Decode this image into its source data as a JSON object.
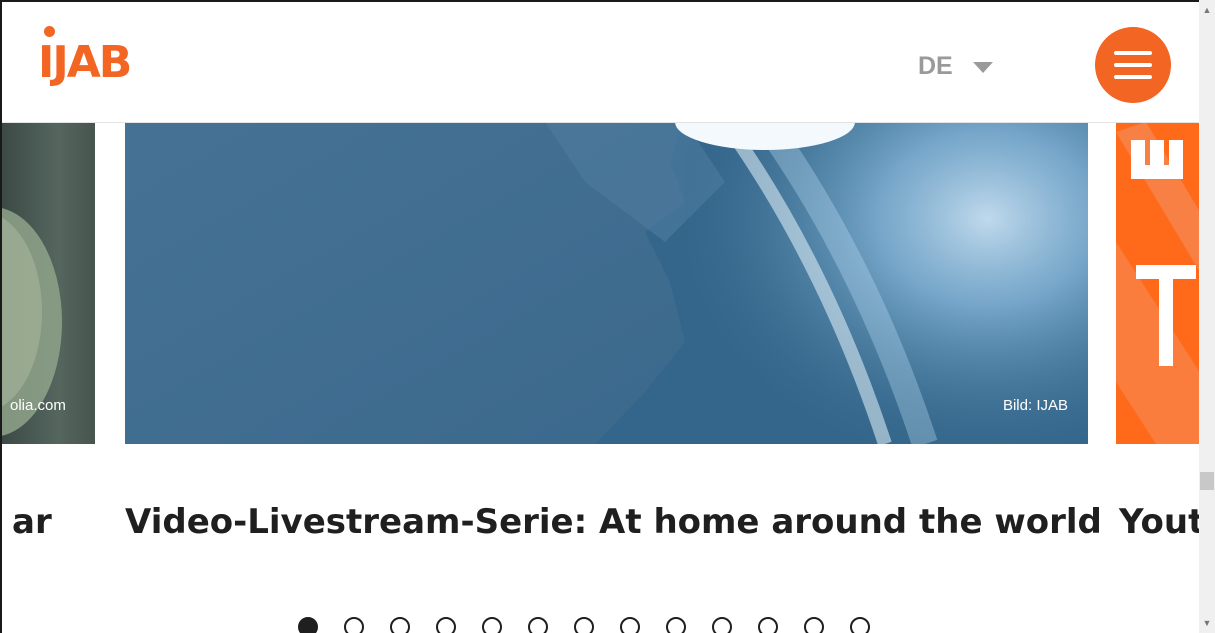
{
  "header": {
    "logo_text": "IJAB",
    "language": "DE",
    "menu_icon": "hamburger-icon"
  },
  "colors": {
    "brand_orange": "#f26522",
    "slide_blue": "#33668a",
    "text_dark": "#1f1f1f",
    "lang_grey": "#9a9a9a"
  },
  "carousel": {
    "left_slide": {
      "credit": "olia.com",
      "title": "ar"
    },
    "main_slide": {
      "credit": "Bild: IJAB",
      "title": "Video-Livestream-Serie: At home around the world"
    },
    "right_slide": {
      "title": "Yout"
    },
    "dot_count": 13,
    "active_dot": 0
  },
  "scrollbar": {
    "up_icon": "chevron-up-icon",
    "down_icon": "chevron-down-icon"
  }
}
